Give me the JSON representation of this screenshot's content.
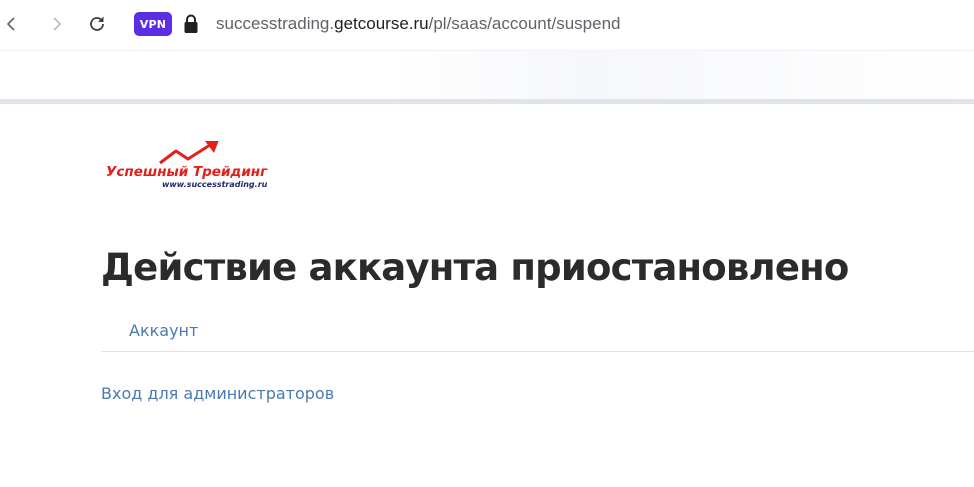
{
  "browser": {
    "vpn_badge": "VPN",
    "url": {
      "prefix": "successtrading.",
      "host": "getcourse.ru",
      "path": "/pl/saas/account/suspend"
    }
  },
  "logo": {
    "title": "Успешный Трейдинг",
    "subtitle": "www.successtrading.ru",
    "colors": {
      "red": "#e1201a",
      "navy": "#1b2a6b"
    }
  },
  "page": {
    "title": "Действие аккаунта приостановлено",
    "tab_account": "Аккаунт",
    "admin_link": "Вход для администраторов"
  },
  "colors": {
    "title": "#2b2b2b",
    "link": "#4a79b1",
    "vpn": "#5b2ee5"
  }
}
